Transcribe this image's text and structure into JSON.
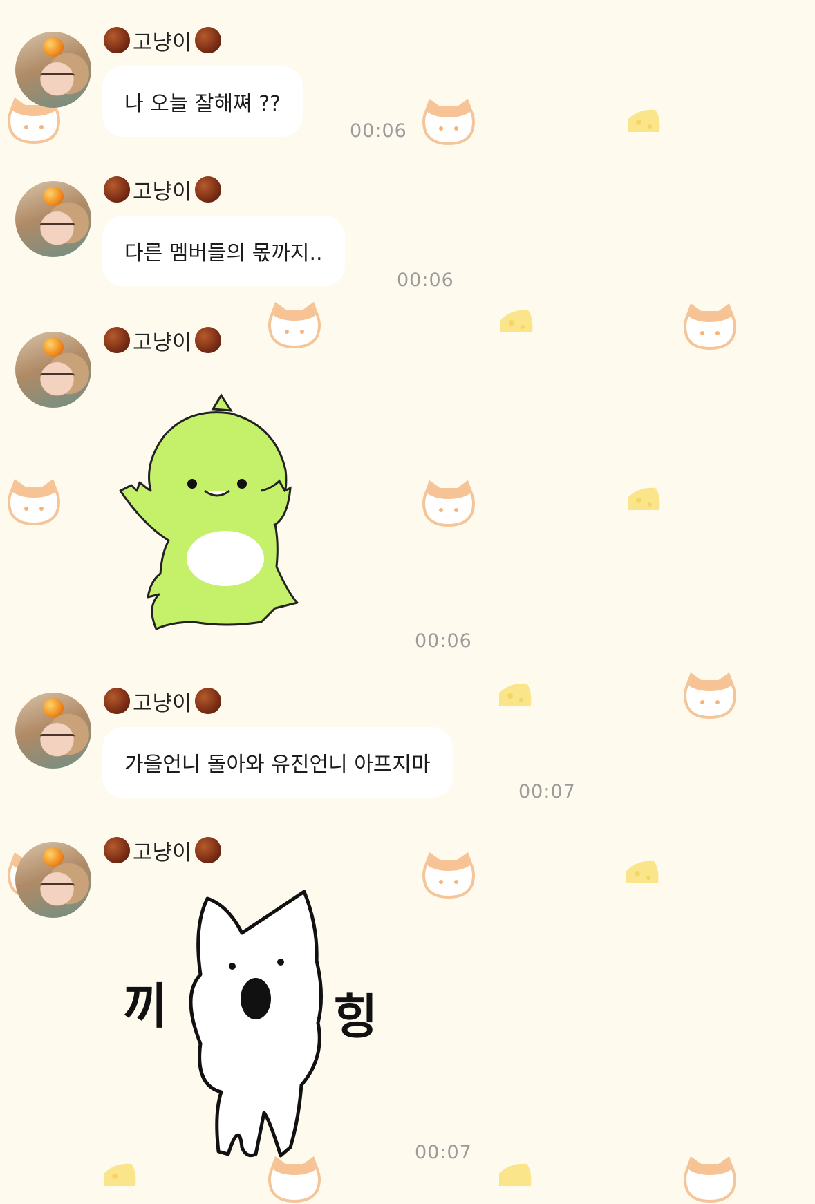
{
  "messages": [
    {
      "sender": "고냥이",
      "type": "text",
      "text": "나 오늘 잘해쪄 ??",
      "time": "00:06"
    },
    {
      "sender": "고냥이",
      "type": "text",
      "text": "다른 멤버들의 몫까지..",
      "time": "00:06"
    },
    {
      "sender": "고냥이",
      "type": "sticker",
      "sticker": "green-dino-sticker",
      "time": "00:06"
    },
    {
      "sender": "고냥이",
      "type": "text",
      "text": "가을언니 돌아와 유진언니 아프지마",
      "time": "00:07"
    },
    {
      "sender": "고냥이",
      "type": "sticker",
      "sticker": "white-dog-sticker",
      "sticker_text_left": "끼",
      "sticker_text_right": "힝",
      "time": "00:07"
    }
  ],
  "icons": {
    "name_decoration": "chestnut-icon",
    "avatar": "profile-avatar"
  },
  "colors": {
    "background": "#fffaee",
    "bubble": "#ffffff",
    "time_text": "#9b9b9b",
    "dino": "#c4f06a"
  }
}
